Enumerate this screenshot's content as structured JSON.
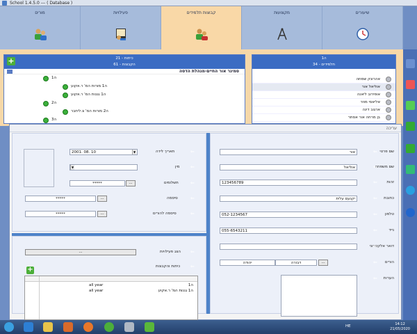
{
  "window": {
    "title": "School 1.4.5.0 --- ( Database )"
  },
  "tabs": [
    {
      "label": "מורים",
      "icon": "teachers-icon"
    },
    {
      "label": "פעילויות",
      "icon": "activities-icon"
    },
    {
      "label": "קבוצות תלמידים",
      "icon": "student-groups-icon",
      "active": true
    },
    {
      "label": "מקצועות",
      "icon": "subjects-icon"
    },
    {
      "label": "שיעורים",
      "icon": "lessons-clock-icon"
    }
  ],
  "left_panel": {
    "head_line1": "כיתות - 21",
    "head_line2": "הקבצות - 61",
    "root_label": "סמינר אור החיים-מנהלת הדסה",
    "nodes": [
      {
        "label": "ה1"
      },
      {
        "label": "ה1 מורות המ' ר.אקוע"
      },
      {
        "label": "ה1 גננות המ' ר.אקוע"
      },
      {
        "label": "ה2"
      },
      {
        "label": "ה2 מורות המ' צ.ליחבר"
      },
      {
        "label": "ה3"
      }
    ]
  },
  "right_panel": {
    "head_line1": "ה1",
    "head_line2": "תלמידים - 34",
    "students": [
      "אהרונק שמחה",
      "אוליאל אור",
      "אופירוב ליאנה",
      "אליאסי מוזר",
      "ארגוב דינה",
      "בן מרחה אור אסתר"
    ]
  },
  "dialog": {
    "title": "עריכה",
    "fields": {
      "first_name_label": "שם פרטי",
      "first_name_value": "אור",
      "last_name_label": "שם משפחה",
      "last_name_value": "אוליאל",
      "id_label": "זהות",
      "id_value": "123456789",
      "address_label": "כתובת",
      "address_value": "יקנעם עלית",
      "phone_label": "טלפון",
      "phone_value": "052-1234567",
      "mobile_label": "נייד",
      "mobile_value": "055-6543211",
      "email_label": "דואר אלקטרוני",
      "email_value": "",
      "parents_label": "הורים",
      "parent_mother": "דבורה",
      "parent_father": "יהודה",
      "notes_label": "הערות",
      "birthdate_label": "תאריך לידה",
      "birthdate_value": "2001. 08. 10",
      "gender_label": "מין",
      "gender_value": "",
      "payments_label": "תשלומים",
      "payments_value": "*****",
      "password_label": "סיסמה",
      "password_value": "*****",
      "parent_password_label": "סיסמה להורים",
      "parent_password_value": "*****",
      "add_activity_label": "הצג פעילויות",
      "classes_groups_label": "כיתות והקבצות",
      "ellipsis": "..."
    },
    "table_rows": [
      {
        "group": "ה1",
        "period": "all year"
      },
      {
        "group": "ה1 גננות המ' ר.אקוע",
        "period": "all year"
      }
    ]
  },
  "taskbar": {
    "lang": "HE",
    "time": "14:12",
    "date": "21/05/2020"
  },
  "colors": {
    "active_tab": "#f9d8a7",
    "header_blue": "#3b6cc3",
    "divider_blue": "#4e83c9"
  }
}
